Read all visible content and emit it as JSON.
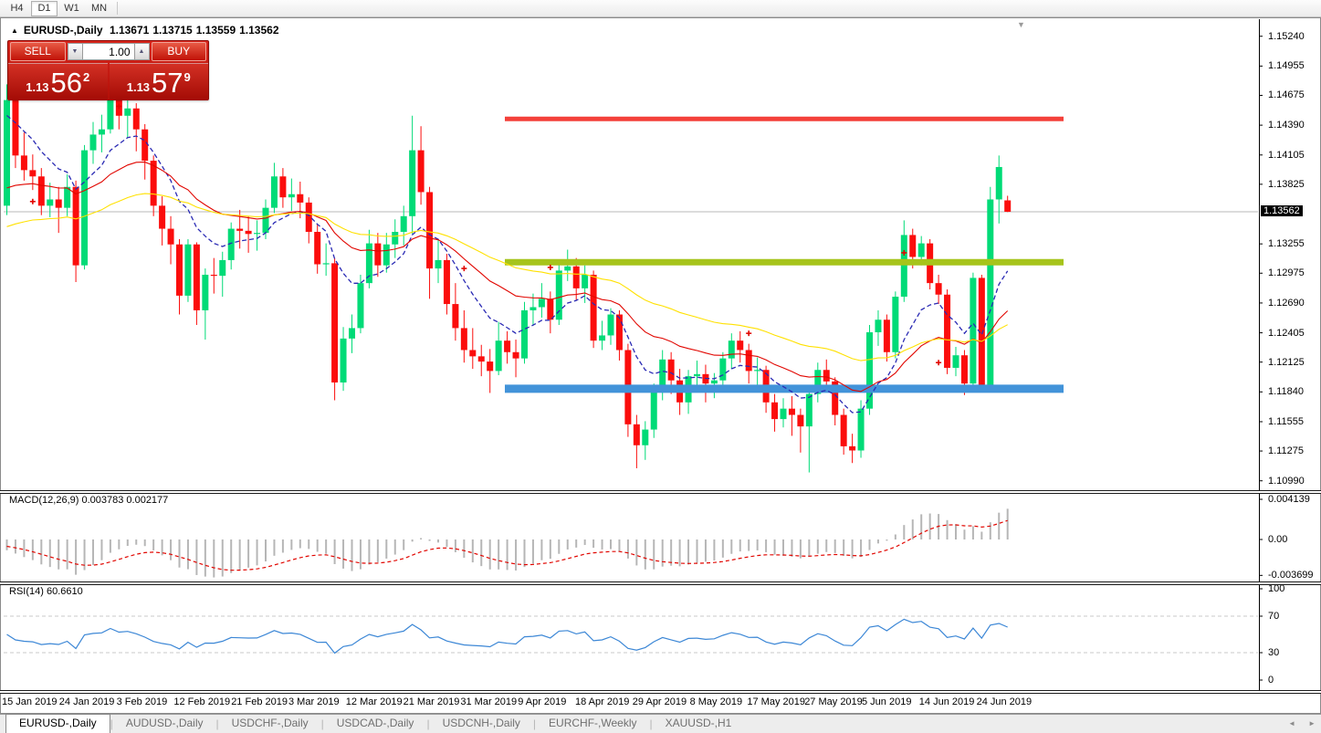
{
  "toolbar": {
    "timeframes": [
      {
        "label": "H4",
        "active": false
      },
      {
        "label": "D1",
        "active": true
      },
      {
        "label": "W1",
        "active": false
      },
      {
        "label": "MN",
        "active": false
      }
    ]
  },
  "icons": {
    "collapse_arrow": "▲",
    "chart_shift": "▼",
    "spin_down": "▼",
    "spin_up": "▲",
    "scroll_left": "◄",
    "scroll_right": "►"
  },
  "chart_header": {
    "symbol": "EURUSD-,Daily",
    "open": "1.13671",
    "high": "1.13715",
    "low": "1.13559",
    "close": "1.13562"
  },
  "trade_panel": {
    "sell_label": "SELL",
    "buy_label": "BUY",
    "volume": "1.00",
    "sell_price": {
      "prefix": "1.13",
      "main": "56",
      "pips": "2"
    },
    "buy_price": {
      "prefix": "1.13",
      "main": "57",
      "pips": "9"
    }
  },
  "indicators": {
    "macd_label": "MACD(12,26,9) 0.003783 0.002177",
    "rsi_label": "RSI(14) 60.6610"
  },
  "price_axis": {
    "current": "1.13562",
    "ticks": [
      1.1524,
      1.14955,
      1.14675,
      1.1439,
      1.14105,
      1.13825,
      1.13255,
      1.12975,
      1.1269,
      1.12405,
      1.12125,
      1.1184,
      1.11555,
      1.11275,
      1.1099
    ]
  },
  "macd_axis": [
    {
      "label": "0.004139",
      "value": 0.004139
    },
    {
      "label": "0.00",
      "value": 0
    },
    {
      "label": "-0.003699",
      "value": -0.003699
    }
  ],
  "rsi_axis": [
    {
      "label": "100",
      "value": 100
    },
    {
      "label": "70",
      "value": 70
    },
    {
      "label": "30",
      "value": 30
    },
    {
      "label": "0",
      "value": 0
    }
  ],
  "date_axis": [
    "15 Jan 2019",
    "24 Jan 2019",
    "3 Feb 2019",
    "12 Feb 2019",
    "21 Feb 2019",
    "3 Mar 2019",
    "12 Mar 2019",
    "21 Mar 2019",
    "31 Mar 2019",
    "9 Apr 2019",
    "18 Apr 2019",
    "29 Apr 2019",
    "8 May 2019",
    "17 May 2019",
    "27 May 2019",
    "5 Jun 2019",
    "14 Jun 2019",
    "24 Jun 2019"
  ],
  "tabs": [
    {
      "label": "EURUSD-,Daily",
      "active": true
    },
    {
      "label": "AUDUSD-,Daily",
      "active": false
    },
    {
      "label": "USDCHF-,Daily",
      "active": false
    },
    {
      "label": "USDCAD-,Daily",
      "active": false
    },
    {
      "label": "USDCNH-,Daily",
      "active": false
    },
    {
      "label": "EURCHF-,Weekly",
      "active": false
    },
    {
      "label": "XAUUSD-,H1",
      "active": false
    }
  ],
  "chart_data": {
    "type": "candlestick",
    "symbol": "EURUSD-",
    "timeframe": "Daily",
    "title": "EURUSD-,Daily",
    "ohlc_display": {
      "open": 1.13671,
      "high": 1.13715,
      "low": 1.13559,
      "close": 1.13562
    },
    "ylim": [
      1.1089,
      1.1539
    ],
    "bull_color": "#00db77",
    "bear_color": "#fb0d0c",
    "bid_price": 1.13562,
    "candles": [
      [
        1.1362,
        1.1478,
        1.1353,
        1.1463
      ],
      [
        1.1463,
        1.1468,
        1.1398,
        1.141
      ],
      [
        1.141,
        1.1432,
        1.1386,
        1.1396
      ],
      [
        1.1396,
        1.1411,
        1.1377,
        1.139
      ],
      [
        1.139,
        1.1398,
        1.1353,
        1.1362
      ],
      [
        1.1362,
        1.1384,
        1.1351,
        1.1368
      ],
      [
        1.1368,
        1.138,
        1.1336,
        1.136
      ],
      [
        1.136,
        1.1392,
        1.1352,
        1.138
      ],
      [
        1.138,
        1.1386,
        1.1289,
        1.1305
      ],
      [
        1.1305,
        1.142,
        1.1301,
        1.1415
      ],
      [
        1.1415,
        1.1442,
        1.1402,
        1.143
      ],
      [
        1.143,
        1.1449,
        1.1413,
        1.1435
      ],
      [
        1.1435,
        1.1502,
        1.1431,
        1.148
      ],
      [
        1.148,
        1.1515,
        1.1435,
        1.1448
      ],
      [
        1.1448,
        1.1464,
        1.1427,
        1.1455
      ],
      [
        1.1455,
        1.146,
        1.1414,
        1.1435
      ],
      [
        1.1435,
        1.144,
        1.1387,
        1.1405
      ],
      [
        1.1405,
        1.141,
        1.1352,
        1.1362
      ],
      [
        1.1362,
        1.1371,
        1.1324,
        1.134
      ],
      [
        1.134,
        1.1352,
        1.1306,
        1.1325
      ],
      [
        1.1325,
        1.133,
        1.1258,
        1.1276
      ],
      [
        1.1276,
        1.133,
        1.127,
        1.1325
      ],
      [
        1.1325,
        1.1327,
        1.1248,
        1.1262
      ],
      [
        1.1262,
        1.1302,
        1.1234,
        1.1296
      ],
      [
        1.1296,
        1.1312,
        1.1278,
        1.1295
      ],
      [
        1.1295,
        1.1318,
        1.1275,
        1.131
      ],
      [
        1.131,
        1.1346,
        1.1301,
        1.134
      ],
      [
        1.134,
        1.1358,
        1.1321,
        1.1338
      ],
      [
        1.1338,
        1.1352,
        1.1317,
        1.1335
      ],
      [
        1.1335,
        1.1348,
        1.1319,
        1.1336
      ],
      [
        1.1336,
        1.1368,
        1.133,
        1.136
      ],
      [
        1.136,
        1.1403,
        1.1355,
        1.139
      ],
      [
        1.139,
        1.1398,
        1.136,
        1.137
      ],
      [
        1.137,
        1.1388,
        1.1357,
        1.1373
      ],
      [
        1.1373,
        1.1385,
        1.135,
        1.1365
      ],
      [
        1.1365,
        1.137,
        1.1326,
        1.1337
      ],
      [
        1.1337,
        1.1344,
        1.1297,
        1.1306
      ],
      [
        1.1306,
        1.1326,
        1.1295,
        1.1307
      ],
      [
        1.1307,
        1.1312,
        1.1176,
        1.1193
      ],
      [
        1.1193,
        1.1246,
        1.1185,
        1.1235
      ],
      [
        1.1235,
        1.1258,
        1.1221,
        1.1245
      ],
      [
        1.1245,
        1.1296,
        1.124,
        1.1288
      ],
      [
        1.1288,
        1.1339,
        1.1283,
        1.1326
      ],
      [
        1.1326,
        1.1336,
        1.1294,
        1.1305
      ],
      [
        1.1305,
        1.1336,
        1.1298,
        1.1325
      ],
      [
        1.1325,
        1.1349,
        1.1312,
        1.1337
      ],
      [
        1.1337,
        1.1362,
        1.1324,
        1.1352
      ],
      [
        1.1352,
        1.1448,
        1.1335,
        1.1415
      ],
      [
        1.1415,
        1.1438,
        1.1363,
        1.1375
      ],
      [
        1.1375,
        1.138,
        1.1273,
        1.1302
      ],
      [
        1.1302,
        1.133,
        1.1288,
        1.131
      ],
      [
        1.131,
        1.1316,
        1.1258,
        1.1268
      ],
      [
        1.1268,
        1.1288,
        1.1233,
        1.1245
      ],
      [
        1.1245,
        1.1262,
        1.1212,
        1.1224
      ],
      [
        1.1224,
        1.1245,
        1.1206,
        1.1218
      ],
      [
        1.1218,
        1.1229,
        1.1199,
        1.1213
      ],
      [
        1.1213,
        1.1225,
        1.1183,
        1.1204
      ],
      [
        1.1204,
        1.1251,
        1.12,
        1.1233
      ],
      [
        1.1233,
        1.1242,
        1.1211,
        1.1222
      ],
      [
        1.1222,
        1.1234,
        1.1198,
        1.1216
      ],
      [
        1.1216,
        1.127,
        1.1211,
        1.1262
      ],
      [
        1.1262,
        1.1278,
        1.1248,
        1.1265
      ],
      [
        1.1265,
        1.1288,
        1.1255,
        1.1273
      ],
      [
        1.1273,
        1.128,
        1.124,
        1.1253
      ],
      [
        1.1253,
        1.1307,
        1.1248,
        1.13
      ],
      [
        1.13,
        1.132,
        1.129,
        1.1304
      ],
      [
        1.1304,
        1.1312,
        1.1272,
        1.1283
      ],
      [
        1.1283,
        1.1305,
        1.1269,
        1.1296
      ],
      [
        1.1296,
        1.13,
        1.1226,
        1.1233
      ],
      [
        1.1233,
        1.1252,
        1.1224,
        1.1238
      ],
      [
        1.1238,
        1.1264,
        1.1229,
        1.1258
      ],
      [
        1.1258,
        1.1262,
        1.1214,
        1.1224
      ],
      [
        1.1224,
        1.123,
        1.1141,
        1.1153
      ],
      [
        1.1153,
        1.1162,
        1.1111,
        1.1133
      ],
      [
        1.1133,
        1.1156,
        1.1119,
        1.1148
      ],
      [
        1.1148,
        1.1192,
        1.114,
        1.1185
      ],
      [
        1.1185,
        1.1224,
        1.1176,
        1.1215
      ],
      [
        1.1215,
        1.1222,
        1.1182,
        1.1195
      ],
      [
        1.1195,
        1.1206,
        1.1162,
        1.1174
      ],
      [
        1.1174,
        1.1205,
        1.1163,
        1.1199
      ],
      [
        1.1199,
        1.1214,
        1.1185,
        1.1201
      ],
      [
        1.1201,
        1.121,
        1.1174,
        1.1192
      ],
      [
        1.1192,
        1.1202,
        1.1178,
        1.1195
      ],
      [
        1.1195,
        1.1222,
        1.1187,
        1.1216
      ],
      [
        1.1216,
        1.124,
        1.1206,
        1.1233
      ],
      [
        1.1233,
        1.1242,
        1.1212,
        1.1224
      ],
      [
        1.1224,
        1.123,
        1.1192,
        1.1204
      ],
      [
        1.1204,
        1.1217,
        1.119,
        1.1205
      ],
      [
        1.1205,
        1.1209,
        1.1164,
        1.1174
      ],
      [
        1.1174,
        1.1182,
        1.1146,
        1.1158
      ],
      [
        1.1158,
        1.1178,
        1.115,
        1.1168
      ],
      [
        1.1168,
        1.118,
        1.1142,
        1.1162
      ],
      [
        1.1162,
        1.1168,
        1.1126,
        1.1151
      ],
      [
        1.1151,
        1.1188,
        1.1107,
        1.1182
      ],
      [
        1.1182,
        1.1212,
        1.1174,
        1.1205
      ],
      [
        1.1205,
        1.1215,
        1.1184,
        1.1194
      ],
      [
        1.1194,
        1.1198,
        1.1152,
        1.1162
      ],
      [
        1.1162,
        1.1168,
        1.1124,
        1.1132
      ],
      [
        1.1132,
        1.1144,
        1.1116,
        1.1128
      ],
      [
        1.1128,
        1.1176,
        1.1121,
        1.1168
      ],
      [
        1.1168,
        1.1248,
        1.1162,
        1.1241
      ],
      [
        1.1241,
        1.1262,
        1.1228,
        1.1253
      ],
      [
        1.1253,
        1.1258,
        1.1213,
        1.1222
      ],
      [
        1.1222,
        1.128,
        1.1216,
        1.1275
      ],
      [
        1.1275,
        1.1348,
        1.127,
        1.1334
      ],
      [
        1.1334,
        1.134,
        1.1302,
        1.1313
      ],
      [
        1.1313,
        1.1333,
        1.1305,
        1.1326
      ],
      [
        1.1326,
        1.133,
        1.1282,
        1.1288
      ],
      [
        1.1288,
        1.1296,
        1.1268,
        1.1277
      ],
      [
        1.1277,
        1.1282,
        1.1201,
        1.1207
      ],
      [
        1.1207,
        1.1227,
        1.1199,
        1.1219
      ],
      [
        1.1219,
        1.1224,
        1.1181,
        1.1192
      ],
      [
        1.1192,
        1.1298,
        1.1188,
        1.1293
      ],
      [
        1.1293,
        1.1296,
        1.1184,
        1.1189
      ],
      [
        1.1189,
        1.138,
        1.1186,
        1.1368
      ],
      [
        1.1368,
        1.141,
        1.1345,
        1.1399
      ],
      [
        1.13671,
        1.13715,
        1.13559,
        1.13562
      ]
    ],
    "moving_averages": [
      {
        "name": "fast-ma",
        "period": 10,
        "color": "#2a2ab4",
        "style": "dash",
        "seed": 1.1445
      },
      {
        "name": "mid-ma",
        "period": 25,
        "color": "#e10600",
        "style": "solid",
        "seed": 1.1372
      },
      {
        "name": "slow-ma",
        "period": 50,
        "color": "#ffe100",
        "style": "solid",
        "seed": 1.1337
      }
    ],
    "horizontal_lines": [
      {
        "name": "resistance",
        "price": 1.1445,
        "color": "#f4403a",
        "thickness": 5
      },
      {
        "name": "mid-support",
        "price": 1.1308,
        "color": "#a6c41b",
        "thickness": 7
      },
      {
        "name": "major-support",
        "price": 1.1187,
        "color": "#4293d9",
        "thickness": 9
      }
    ],
    "trade_markers": [
      {
        "index": 3,
        "price": 1.1366
      },
      {
        "index": 13,
        "price": 1.1457
      },
      {
        "index": 53,
        "price": 1.1302
      },
      {
        "index": 63,
        "price": 1.1303
      },
      {
        "index": 86,
        "price": 1.124
      },
      {
        "index": 104,
        "price": 1.1317
      },
      {
        "index": 108,
        "price": 1.1212
      }
    ],
    "macd": {
      "params": [
        12,
        26,
        9
      ],
      "main": 0.003783,
      "signal": 0.002177,
      "axis": [
        0.004139,
        0.0,
        -0.003699
      ],
      "histogram_color": "#b6b6b6",
      "signal_color": "#e10600"
    },
    "rsi": {
      "period": 14,
      "value": 60.661,
      "levels": [
        70,
        30
      ],
      "color": "#3c87d6"
    }
  }
}
